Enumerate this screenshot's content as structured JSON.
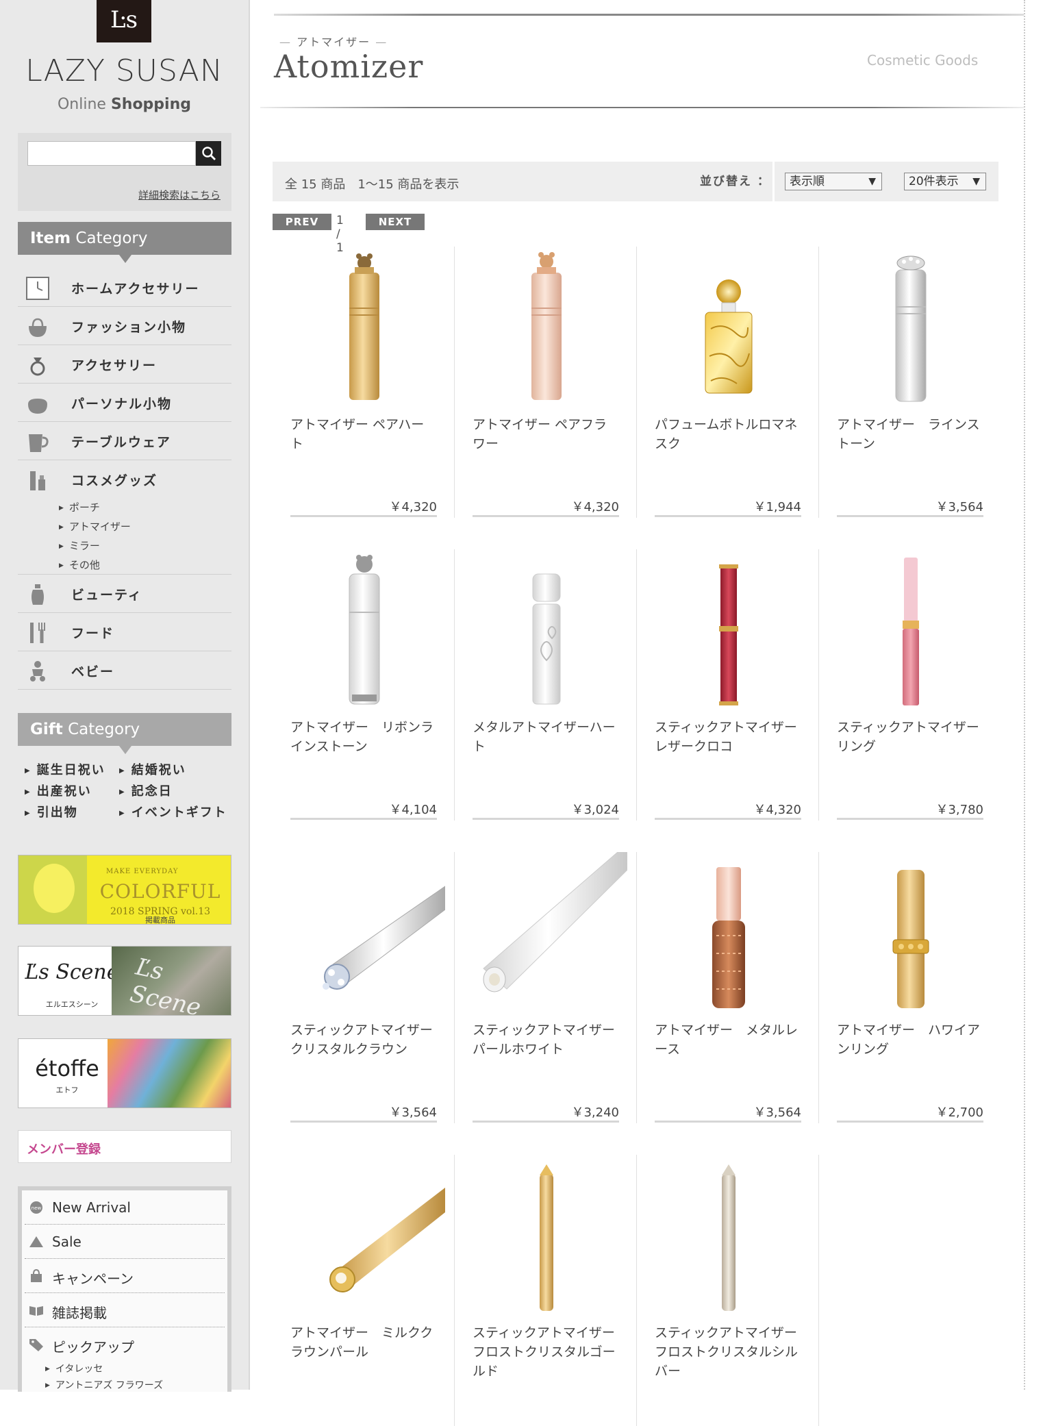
{
  "brand": {
    "mark": "Ŀs",
    "name": "LAZY SUSAN",
    "sub_light": "Online",
    "sub_bold": "Shopping"
  },
  "search": {
    "value": "",
    "advanced_link": "詳細検索はこちら"
  },
  "item_category": {
    "title_bold": "Item",
    "title_rest": " Category",
    "items": [
      {
        "label": "ホームアクセサリー",
        "icon": "clock-icon"
      },
      {
        "label": "ファッション小物",
        "icon": "handbag-icon"
      },
      {
        "label": "アクセサリー",
        "icon": "ring-icon"
      },
      {
        "label": "パーソナル小物",
        "icon": "pouch-icon"
      },
      {
        "label": "テーブルウェア",
        "icon": "mug-icon"
      },
      {
        "label": "コスメグッズ",
        "icon": "lipstick-icon"
      },
      {
        "label": "ビューティ",
        "icon": "bottle-icon"
      },
      {
        "label": "フード",
        "icon": "cutlery-icon"
      },
      {
        "label": "ベビー",
        "icon": "baby-icon"
      }
    ],
    "cosme_sub": [
      "ポーチ",
      "アトマイザー",
      "ミラー",
      "その他"
    ]
  },
  "gift_category": {
    "title_bold": "Gift",
    "title_rest": " Category",
    "items": [
      "誕生日祝い",
      "結婚祝い",
      "出産祝い",
      "記念日",
      "引出物",
      "イベントギフト"
    ]
  },
  "banners": {
    "colorful_small": "MAKE EVERYDAY",
    "colorful_big": "COLORFUL",
    "colorful_vol": "2018 SPRING vol.13",
    "colorful_jp": "掲載商品",
    "colorful_tag": "COLORFUL",
    "scene_logo": "Ľs Scene",
    "scene_sub": "エルエスシーン",
    "scene_photo": "Ľs Scene",
    "etoffe_logo": "étoffe",
    "etoffe_sub": "エトフ"
  },
  "member": {
    "label": "メンバー登録"
  },
  "bottom_nav": {
    "items": [
      {
        "label": "New Arrival",
        "icon": "new-badge-icon"
      },
      {
        "label": "Sale",
        "icon": "sale-tag-icon"
      },
      {
        "label": "キャンペーン",
        "icon": "shopping-bag-icon"
      },
      {
        "label": "雑誌掲載",
        "icon": "book-icon"
      },
      {
        "label": "ピックアップ",
        "icon": "tag-icon"
      }
    ],
    "pickup_sub": [
      "イタレッセ",
      "アントニアズ フラワーズ"
    ]
  },
  "page": {
    "kana": "アトマイザー",
    "title": "Atomizer",
    "tag": "Cosmetic Goods"
  },
  "listing": {
    "count_text": "全 15 商品　1〜15 商品を表示",
    "sort_label": "並び替え ：",
    "sort_value": "表示順",
    "per_page_value": "20件表示",
    "prev": "PREV",
    "next": "NEXT",
    "page_indicator": "1 / 1"
  },
  "products": [
    {
      "name": "アトマイザー ペアハート",
      "price": "￥4,320",
      "style": "gold-tube-bear"
    },
    {
      "name": "アトマイザー ペアフラワー",
      "price": "￥4,320",
      "style": "pink-tube-bear"
    },
    {
      "name": "パフュームボトルロマネスク",
      "price": "￥1,944",
      "style": "gold-bottle"
    },
    {
      "name": "アトマイザー　ラインストーン",
      "price": "￥3,564",
      "style": "silver-tube"
    },
    {
      "name": "アトマイザー　リボンラインストーン",
      "price": "￥4,104",
      "style": "white-tube-bear"
    },
    {
      "name": "メタルアトマイザーハート",
      "price": "￥3,024",
      "style": "white-heart-tube"
    },
    {
      "name": "スティックアトマイザーレザークロコ",
      "price": "￥4,320",
      "style": "red-stick"
    },
    {
      "name": "スティックアトマイザーリング",
      "price": "￥3,780",
      "style": "pink-stick"
    },
    {
      "name": "スティックアトマイザークリスタルクラウン",
      "price": "￥3,564",
      "style": "silver-diagonal-crown"
    },
    {
      "name": "スティックアトマイザー　パールホワイト",
      "price": "￥3,240",
      "style": "white-diagonal"
    },
    {
      "name": "アトマイザー　メタルレース",
      "price": "￥3,564",
      "style": "copper-lace"
    },
    {
      "name": "アトマイザー　ハワイアンリング",
      "price": "￥2,700",
      "style": "gold-hawaiian"
    },
    {
      "name": "アトマイザー　ミルククラウンパール",
      "price": "",
      "style": "gold-diagonal-crown"
    },
    {
      "name": "スティックアトマイザーフロストクリスタルゴールド",
      "price": "",
      "style": "gold-slim"
    },
    {
      "name": "スティックアトマイザーフロストクリスタルシルバー",
      "price": "",
      "style": "silver-slim"
    }
  ],
  "colors": {
    "sidebar_bg": "#e9e9e9",
    "category_header": "#8a8a8a",
    "member_pink": "#c5488f",
    "pager_gray": "#777777"
  }
}
